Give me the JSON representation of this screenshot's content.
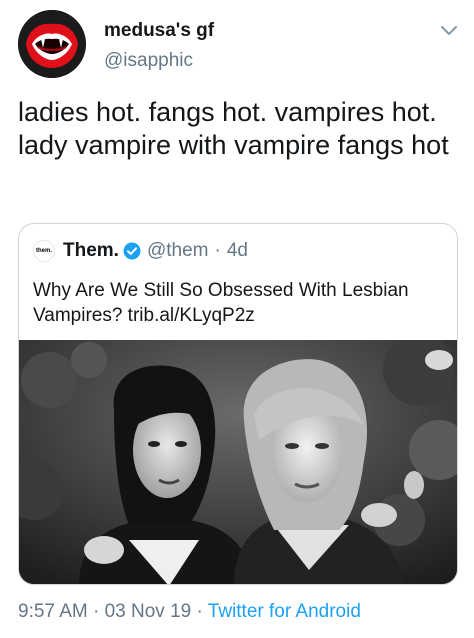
{
  "user": {
    "display_name": "medusa's gf",
    "handle": "@isapphic"
  },
  "tweet": {
    "text": "ladies hot. fangs hot. vampires hot. lady vampire with vampire fangs hot"
  },
  "quoted_tweet": {
    "avatar_text": "them.",
    "display_name": "Them.",
    "handle": "@them",
    "separator": "·",
    "age": "4d",
    "text": "Why Are We Still So Obsessed With Lesbian Vampires? trib.al/KLyqP2z",
    "photo_subject": "black-and-white still of two women with wet hair"
  },
  "footer": {
    "time": "9:57 AM",
    "dot1": "·",
    "date": "03 Nov 19",
    "dot2": "·",
    "source": "Twitter for Android"
  },
  "colors": {
    "text_primary": "#14171a",
    "text_secondary": "#657786",
    "link": "#1da1f2",
    "border": "#ccd6dd",
    "avatar_red": "#e0101a"
  },
  "icons": {
    "avatar": "vampire-mouth-icon",
    "menu": "chevron-down-icon",
    "verified": "verified-badge-icon"
  }
}
